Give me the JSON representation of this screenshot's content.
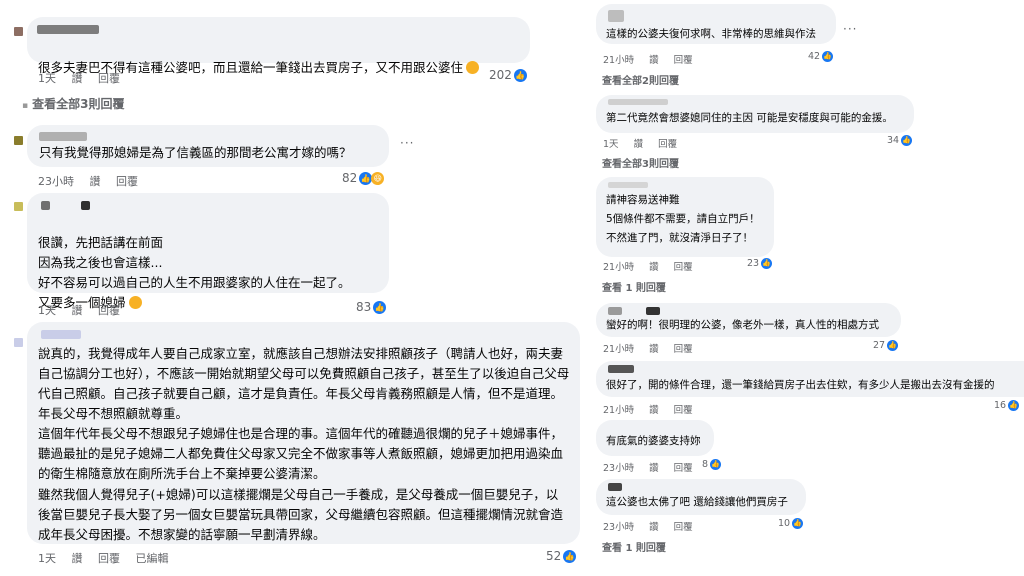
{
  "left": {
    "comments": [
      {
        "text": "很多夫妻巴不得有這種公婆吧，而且還給一筆錢出去買房子，又不用跟公婆住",
        "time": "1天",
        "like_label": "讚",
        "reply_label": "回覆",
        "reactions": "202",
        "view_replies": "查看全部3則回覆"
      },
      {
        "text": "只有我覺得那媳婦是為了信義區的那間老公寓才嫁的嗎？",
        "time": "23小時",
        "like_label": "讚",
        "reply_label": "回覆",
        "reactions": "82"
      },
      {
        "text": "很讚，先把話講在前面\n因為我之後也會這樣...\n好不容易可以過自己的人生不用跟婆家的人住在一起了。\n又要多一個媳婦",
        "time": "1天",
        "like_label": "讚",
        "reply_label": "回覆",
        "reactions": "83"
      },
      {
        "paragraphs": [
          "說真的，我覺得成年人要自己成家立室，就應該自己想辦法安排照顧孩子（聘請人也好，兩夫妻自己協調分工也好），不應該一開始就期望父母可以免費照顧自己孩子，甚至生了以後迫自己父母代自己照顧。自己孩子就要自己顧，這才是負責任。年長父母肯義務照顧是人情，但不是道理。年長父母不想照顧就尊重。",
          "這個年代年長父母不想跟兒子媳婦住也是合理的事。這個年代的確聽過很爛的兒子＋媳婦事件，聽過最扯的是兒子媳婦二人都免費住父母家又完全不做家事等人煮飯照顧，媳婦更加把用過染血的衛生棉隨意放在廁所洗手台上不棄掉要公婆清潔。",
          "雖然我個人覺得兒子(+媳婦)可以這樣擺爛是父母自己一手養成，是父母養成一個巨嬰兒子，以後當巨嬰兒子長大娶了另一個女巨嬰當玩具帶回家，父母繼續包容照顧。但這種擺爛情況就會造成年長父母困擾。不想家變的話寧願一早劃清界線。"
        ],
        "time": "1天",
        "like_label": "讚",
        "reply_label": "回覆",
        "edited_label": "已編輯",
        "reactions": "52"
      }
    ]
  },
  "right": {
    "comments": [
      {
        "text": "這樣的公婆夫復何求啊、非常棒的思維與作法",
        "time": "21小時",
        "like_label": "讚",
        "reply_label": "回覆",
        "reactions": "42",
        "view_replies": "查看全部2則回覆"
      },
      {
        "text": "第二代竟然會想婆媳同住的主因 可能是安穩度與可能的金援。",
        "time": "1天",
        "like_label": "讚",
        "reply_label": "回覆",
        "reactions": "34",
        "view_replies": "查看全部3則回覆"
      },
      {
        "text": "請神容易送神難\n5個條件都不需要，請自立門戶！\n不然進了門，就沒清淨日子了！",
        "time": "21小時",
        "like_label": "讚",
        "reply_label": "回覆",
        "reactions": "23",
        "view_replies": "查看 1 則回覆"
      },
      {
        "text": "蠻好的啊！很明理的公婆，像老外一樣，真人性的相處方式",
        "time": "21小時",
        "like_label": "讚",
        "reply_label": "回覆",
        "reactions": "27"
      },
      {
        "text": "很好了，開的條件合理，還一筆錢給買房子出去住欸，有多少人是搬出去沒有金援的",
        "time": "21小時",
        "like_label": "讚",
        "reply_label": "回覆",
        "reactions": "16"
      },
      {
        "text": "有底氣的婆婆支持妳",
        "time": "23小時",
        "like_label": "讚",
        "reply_label": "回覆",
        "reactions": "8"
      },
      {
        "text": "這公婆也太佛了吧 還給錢讓他們買房子",
        "time": "23小時",
        "like_label": "讚",
        "reply_label": "回覆",
        "reactions": "10",
        "view_replies": "查看 1 則回覆"
      }
    ]
  },
  "colors": {
    "bubble": "#f0f2f5",
    "meta": "#65676b",
    "like": "#1877f2",
    "haha": "#f7b125"
  },
  "icons": {
    "like": "like-icon",
    "haha": "haha-icon",
    "more": "more-options-icon"
  }
}
